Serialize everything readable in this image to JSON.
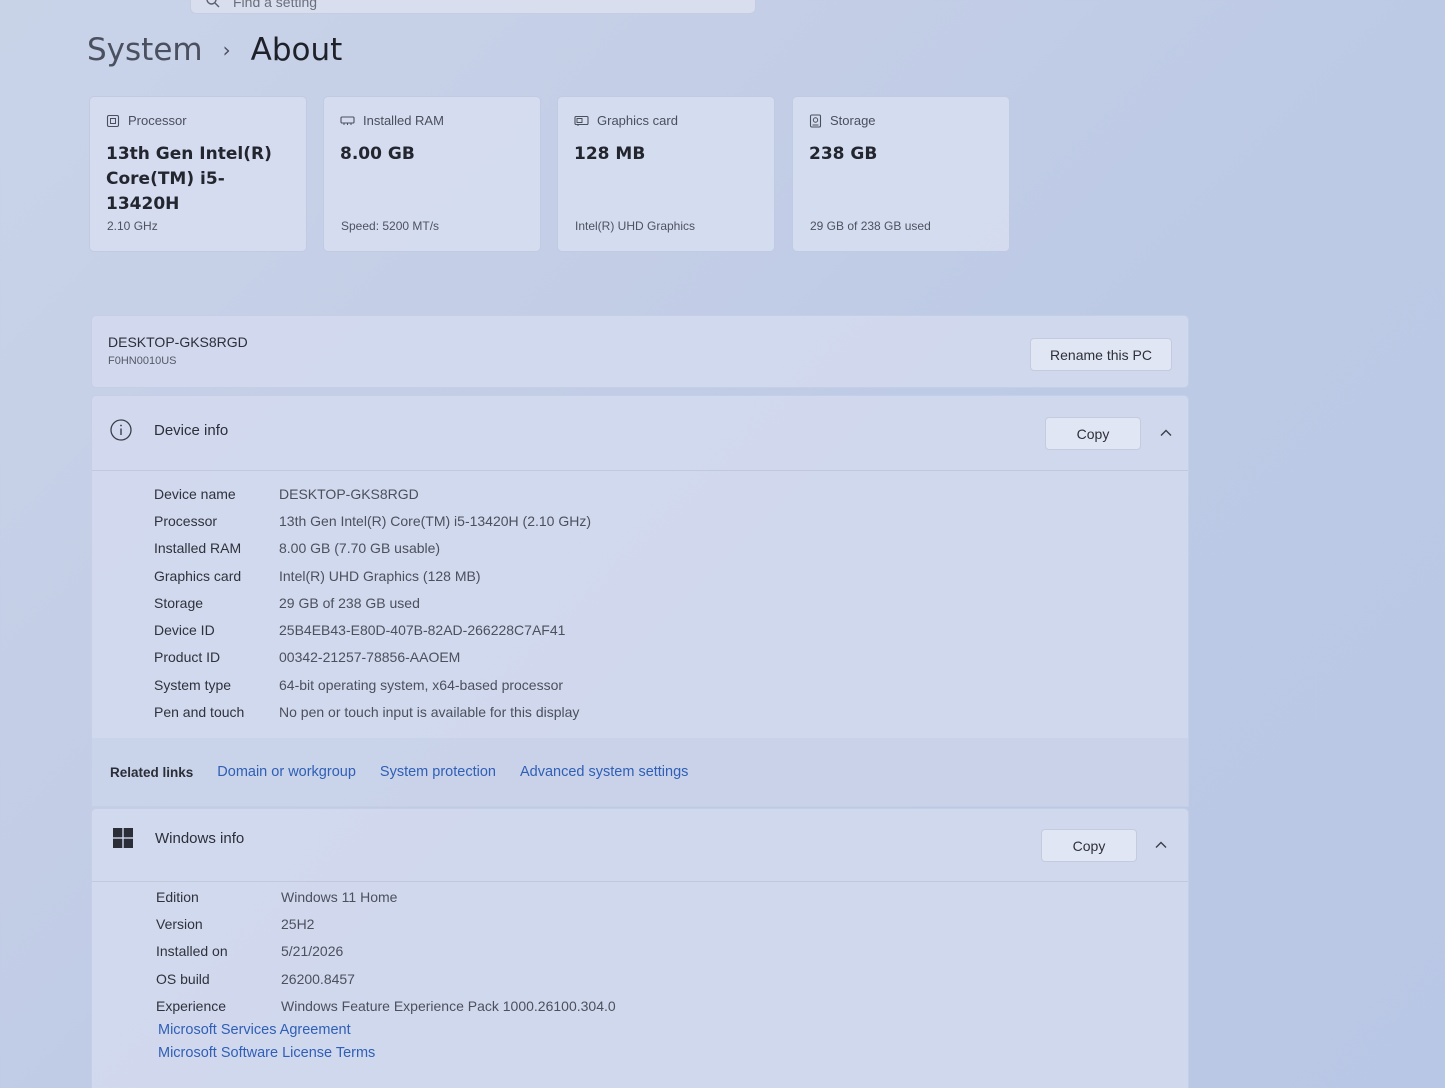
{
  "search": {
    "placeholder": "Find a setting"
  },
  "breadcrumb": {
    "parent": "System",
    "separator": "›",
    "current": "About"
  },
  "specs": [
    {
      "label": "Processor",
      "value": "13th Gen Intel(R) Core(TM) i5-13420H",
      "sub": "2.10 GHz",
      "icon": "processor-icon"
    },
    {
      "label": "Installed RAM",
      "value": "8.00 GB",
      "sub": "Speed: 5200 MT/s",
      "icon": "ram-icon"
    },
    {
      "label": "Graphics card",
      "value": "128 MB",
      "sub": "Intel(R) UHD Graphics",
      "icon": "graphics-card-icon"
    },
    {
      "label": "Storage",
      "value": "238 GB",
      "sub": "29 GB of 238 GB used",
      "icon": "storage-icon"
    }
  ],
  "pc": {
    "name": "DESKTOP-GKS8RGD",
    "model": "F0HN0010US",
    "rename_label": "Rename this PC"
  },
  "device_info": {
    "title": "Device info",
    "copy_label": "Copy",
    "rows": [
      {
        "label": "Device name",
        "value": "DESKTOP-GKS8RGD"
      },
      {
        "label": "Processor",
        "value": "13th Gen Intel(R) Core(TM) i5-13420H (2.10 GHz)"
      },
      {
        "label": "Installed RAM",
        "value": "8.00 GB (7.70 GB usable)"
      },
      {
        "label": "Graphics card",
        "value": "Intel(R) UHD Graphics (128 MB)"
      },
      {
        "label": "Storage",
        "value": "29 GB of 238 GB used"
      },
      {
        "label": "Device ID",
        "value": "25B4EB43-E80D-407B-82AD-266228C7AF41"
      },
      {
        "label": "Product ID",
        "value": "00342-21257-78856-AAOEM"
      },
      {
        "label": "System type",
        "value": "64-bit operating system, x64-based processor"
      },
      {
        "label": "Pen and touch",
        "value": "No pen or touch input is available for this display"
      }
    ]
  },
  "related": {
    "label": "Related links",
    "links": [
      "Domain or workgroup",
      "System protection",
      "Advanced system settings"
    ]
  },
  "windows_info": {
    "title": "Windows info",
    "copy_label": "Copy",
    "rows": [
      {
        "label": "Edition",
        "value": "Windows 11 Home"
      },
      {
        "label": "Version",
        "value": "25H2"
      },
      {
        "label": "Installed on",
        "value": "5/21/2026"
      },
      {
        "label": "OS build",
        "value": "26200.8457"
      },
      {
        "label": "Experience",
        "value": "Windows Feature Experience Pack 1000.26100.304.0"
      }
    ],
    "links": [
      "Microsoft Services Agreement",
      "Microsoft Software License Terms"
    ]
  },
  "colors": {
    "accent_link": "#2f5fb6",
    "background": "#c3cde6"
  }
}
